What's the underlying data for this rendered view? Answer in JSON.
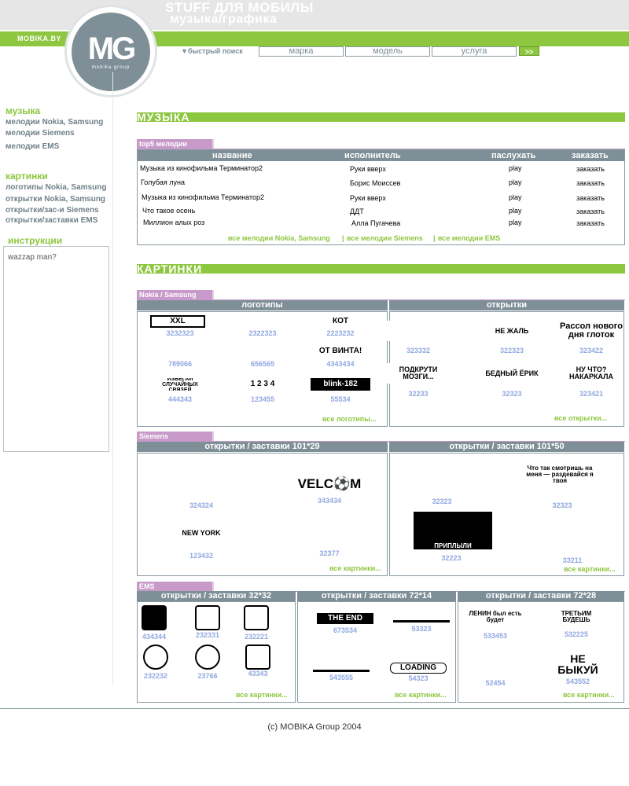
{
  "header": {
    "title_line1": "STUFF ДЛЯ МОБИЛЫ",
    "title_line2": "музыка/графика",
    "brand": "MOBIKA.BY",
    "logo_text": "MG",
    "logo_sub": "mobika group",
    "quick_search": "▼быстрый поиск",
    "fields": [
      "марка",
      "модель",
      "услуга"
    ],
    "go": ">>"
  },
  "sidebar": {
    "music_h": "музыка",
    "music_links": [
      "мелодии Nokia, Samsung",
      "мелодии Siemens",
      "мелодии EMS"
    ],
    "pics_h": "картинки",
    "pics_links": [
      "логотипы Nokia, Samsung",
      "открытки Nokia, Samsung",
      "открытки/зас-и Siemens",
      "открытки/заставки EMS"
    ],
    "instr_h": "инструкции",
    "instr_text": "wazzap man?"
  },
  "music": {
    "title": "МУЗЫКА",
    "tag": "top5 мелодии",
    "cols": [
      "название",
      "исполнитель",
      "паслухать",
      "заказать"
    ],
    "rows": [
      {
        "name": "Музыка из кинофильма Терминатор2",
        "artist": "Руки вверх",
        "play": "play",
        "order": "заказать"
      },
      {
        "name": "Голубая луна",
        "artist": "Борис Моиссев",
        "play": "play",
        "order": "заказать"
      },
      {
        "name": "Музыка из кинофильма Терминатор2",
        "artist": "Руки вверх",
        "play": "play",
        "order": "заказать"
      },
      {
        "name": "Что такое осень",
        "artist": "ДДТ",
        "play": "play",
        "order": "заказать"
      },
      {
        "name": "Миллион алых роз",
        "artist": "Алла Пугачева",
        "play": "play",
        "order": "заказать"
      }
    ],
    "links": [
      "все мелодии Nokia, Samsung",
      "все мелодии Siemens",
      "все мелодии EMS"
    ],
    "sep": "|"
  },
  "pics": {
    "title": "КАРТИНКИ",
    "nokia": {
      "tag": "Nokia / Samsung",
      "logos_h": "логотипы",
      "cards_h": "открытки",
      "logo_codes": [
        "3232323",
        "2322323",
        "2223232",
        "789066",
        "656565",
        "4343434",
        "444343",
        "123455",
        "55534"
      ],
      "logo_texts": [
        "XXL",
        "",
        "КОТ",
        "",
        "",
        "ОТ ВИНТА!",
        "ИЗБЕГАЙ СЛУЧАЙНЫХ СВЯЗЕЙ",
        "1 2 3 4",
        "blink-182"
      ],
      "card_codes": [
        "323332",
        "322323",
        "323422",
        "32233",
        "32323",
        "323421"
      ],
      "card_texts": [
        "",
        "НЕ ЖАЛЬ",
        "Рассол нового дня глоток",
        "ПОДКРУТИ МОЗГИ...",
        "БЕДНЫЙ ЁРИК",
        "НУ ЧТО? НАКАРКАЛА"
      ],
      "logos_more": "все логотипы...",
      "cards_more": "все открытки..."
    },
    "siemens": {
      "tag": "Siemens",
      "left_h": "открытки / заставки 101*29",
      "right_h": "открытки / заставки 101*50",
      "left_codes": [
        "324324",
        "343434",
        "123432",
        "32377"
      ],
      "left_texts": [
        "",
        "VELC⚽M",
        "NEW YORK",
        ""
      ],
      "right_codes": [
        "32323",
        "32323",
        "32223",
        "33211"
      ],
      "right_texts": [
        "",
        "Что так смотришь на меня — раздевайся я твоя",
        "ПРИПЛЫЛИ",
        ""
      ],
      "more": "все картинки..."
    },
    "ems": {
      "tag": "EMS",
      "h1": "открытки / заставки 32*32",
      "h2": "открытки / заставки  72*14",
      "h3": "открытки / заставки 72*28",
      "codes1": [
        "434344",
        "232331",
        "232221",
        "232232",
        "23766",
        "43343"
      ],
      "codes2": [
        "673534",
        "53323",
        "543555",
        "54323"
      ],
      "texts2": [
        "THE END",
        "",
        "",
        "LOADING"
      ],
      "codes3": [
        "533453",
        "532225",
        "52454",
        "543552"
      ],
      "texts3": [
        "ЛЕНИН был есть будет",
        "ТРЕТЬИМ БУДЕШЬ",
        "",
        "НЕ БЫКУЙ"
      ],
      "more": "все картинки..."
    }
  },
  "footer": "(c) MOBIKA Group 2004"
}
